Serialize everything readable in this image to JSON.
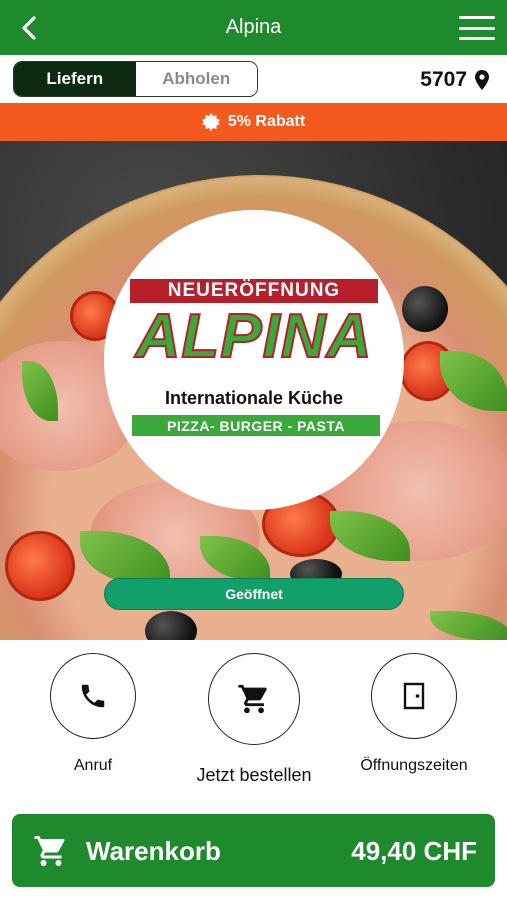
{
  "header": {
    "title": "Alpina",
    "colors": {
      "bar": "#1f8a2d"
    }
  },
  "mode": {
    "options": [
      {
        "label": "Liefern",
        "active": true
      },
      {
        "label": "Abholen",
        "active": false
      }
    ],
    "postal_code": "5707"
  },
  "promo": {
    "text": "5% Rabatt",
    "color": "#f45a1e"
  },
  "logo": {
    "banner": "NEUERÖFFNUNG",
    "name": "ALPINA",
    "subtitle": "Internationale Küche",
    "strip": "PIZZA- BURGER - PASTA"
  },
  "status": {
    "label": "Geöffnet",
    "color": "#11a06a"
  },
  "actions": [
    {
      "label": "Anruf",
      "icon": "phone-icon"
    },
    {
      "label": "Jetzt bestellen",
      "icon": "cart-icon"
    },
    {
      "label": "Öffnungszeiten",
      "icon": "door-icon"
    }
  ],
  "cart": {
    "label": "Warenkorb",
    "total": "49,40 CHF"
  }
}
